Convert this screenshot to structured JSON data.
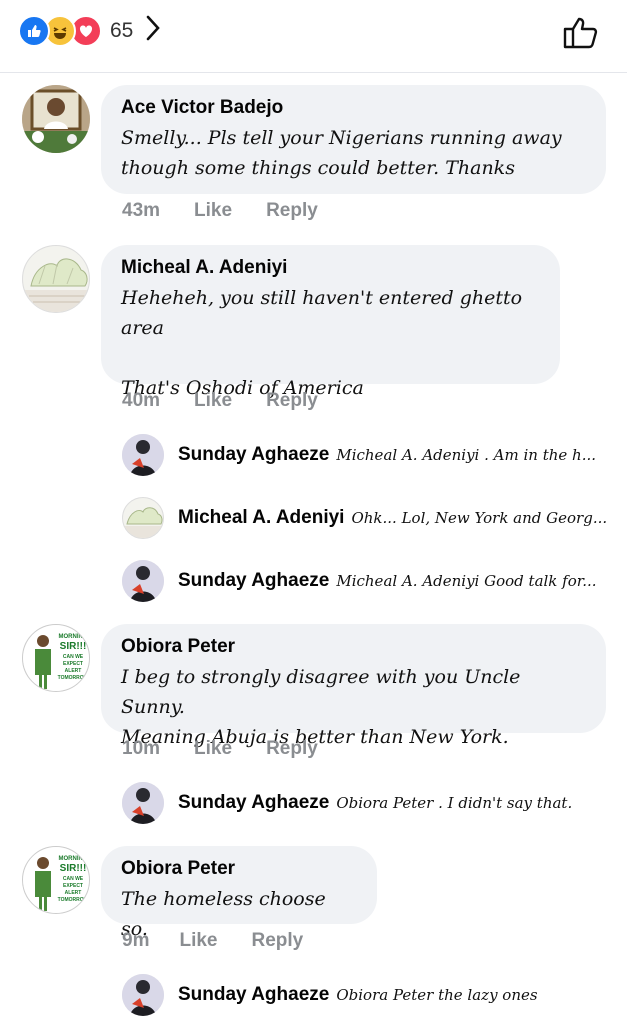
{
  "header": {
    "reactions": [
      "like-icon",
      "haha-icon",
      "love-icon"
    ],
    "reaction_count": "65"
  },
  "comments": [
    {
      "author": "Ace Victor Badejo",
      "text": "Smelly... Pls tell your Nigerians running away\nthough some things could better. Thanks",
      "time": "43m",
      "like": "Like",
      "reply": "Reply"
    },
    {
      "author": "Micheal A. Adeniyi",
      "text": "Heheheh, you still haven't entered ghetto area\n\nThat's Oshodi of America",
      "time": "40m",
      "like": "Like",
      "reply": "Reply",
      "replies": [
        {
          "author": "Sunday Aghaeze",
          "text": "Micheal A. Adeniyi . Am in the h..."
        },
        {
          "author": "Micheal A. Adeniyi",
          "text": "Ohk... Lol, New York and Georg..."
        },
        {
          "author": "Sunday Aghaeze",
          "text": "Micheal A. Adeniyi Good talk for..."
        }
      ]
    },
    {
      "author": "Obiora Peter",
      "text": "I beg to strongly disagree with you Uncle Sunny.\nMeaning Abuja is better than New York.",
      "time": "10m",
      "like": "Like",
      "reply": "Reply",
      "replies": [
        {
          "author": "Sunday Aghaeze",
          "text": "Obiora Peter . I didn't say that."
        }
      ]
    },
    {
      "author": "Obiora Peter",
      "text": "The homeless choose so.",
      "time": "9m",
      "like": "Like",
      "reply": "Reply",
      "replies": [
        {
          "author": "Sunday Aghaeze",
          "text": "Obiora Peter the lazy ones"
        }
      ]
    }
  ],
  "avatar_badge_text": [
    "MORNING",
    "SIR!!!",
    "CAN WE",
    "EXPECT",
    "ALERT",
    "TOMORROW"
  ],
  "colors": {
    "like_blue": "#1877f2",
    "haha_yellow": "#f7c33b",
    "love_red": "#f33e58",
    "bubble_bg": "#f0f2f5",
    "meta_grey": "#8a8d91"
  }
}
